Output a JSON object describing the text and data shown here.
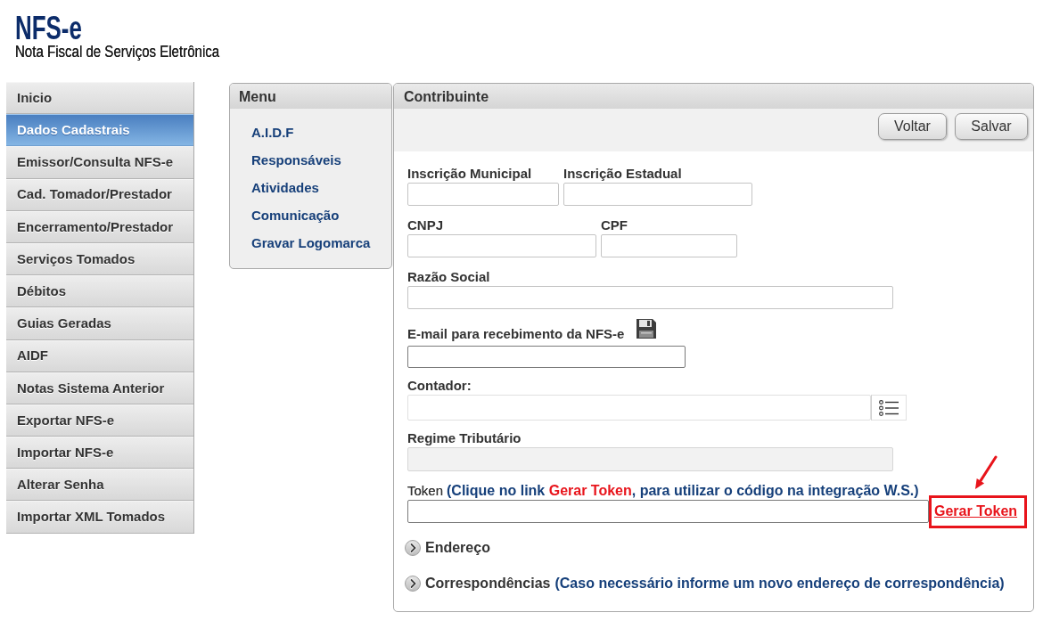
{
  "logo": {
    "title": "NFS-e",
    "subtitle": "Nota Fiscal de Serviços Eletrônica"
  },
  "sidebar": {
    "items": [
      {
        "label": "Inicio",
        "selected": false
      },
      {
        "label": "Dados Cadastrais",
        "selected": true
      },
      {
        "label": "Emissor/Consulta NFS-e",
        "selected": false
      },
      {
        "label": "Cad. Tomador/Prestador",
        "selected": false
      },
      {
        "label": "Encerramento/Prestador",
        "selected": false
      },
      {
        "label": "Serviços Tomados",
        "selected": false
      },
      {
        "label": "Débitos",
        "selected": false
      },
      {
        "label": "Guias Geradas",
        "selected": false
      },
      {
        "label": "AIDF",
        "selected": false
      },
      {
        "label": "Notas Sistema Anterior",
        "selected": false
      },
      {
        "label": "Exportar NFS-e",
        "selected": false
      },
      {
        "label": "Importar NFS-e",
        "selected": false
      },
      {
        "label": "Alterar Senha",
        "selected": false
      },
      {
        "label": "Importar XML Tomados",
        "selected": false
      }
    ]
  },
  "menu": {
    "title": "Menu",
    "items": [
      "A.I.D.F",
      "Responsáveis",
      "Atividades",
      "Comunicação",
      "Gravar Logomarca"
    ]
  },
  "panel": {
    "title": "Contribuinte",
    "buttons": [
      "Voltar",
      "Salvar"
    ],
    "form_rows": [
      [
        {
          "label": "Inscrição Municipal",
          "kind": "text",
          "disabled": false
        },
        {
          "label": "Inscrição Estadual",
          "kind": "text",
          "disabled": false
        }
      ],
      [
        {
          "label": "CNPJ",
          "kind": "text",
          "disabled": false
        },
        {
          "label": "CPF",
          "kind": "text",
          "disabled": false
        }
      ],
      [
        {
          "label": "Razão Social",
          "kind": "text",
          "disabled": false
        }
      ],
      [
        {
          "label": "E-mail para recebimento da NFS-e",
          "kind": "email",
          "disabled": false
        }
      ],
      [
        {
          "label": "Contador:",
          "kind": "lookup",
          "disabled": false
        }
      ],
      [
        {
          "label": "Regime Tributário",
          "kind": "text",
          "disabled": true
        }
      ],
      [
        {
          "label": "Token",
          "kind": "token",
          "disabled": false,
          "hint": [
            {
              "text": "(Clique no link ",
              "kind": "plain"
            },
            {
              "text": "Gerar Token",
              "kind": "link_name"
            },
            {
              "text": ", para utilizar o código na integração W.S.)",
              "kind": "plain"
            }
          ],
          "link": "Gerar Token",
          "highlighted": true
        }
      ]
    ],
    "sections": [
      {
        "title": "Endereço",
        "expanded": false
      },
      {
        "title": "Correspondências",
        "note": "(Caso necessário informe um novo endereço de correspondência)",
        "expanded": false
      }
    ]
  }
}
